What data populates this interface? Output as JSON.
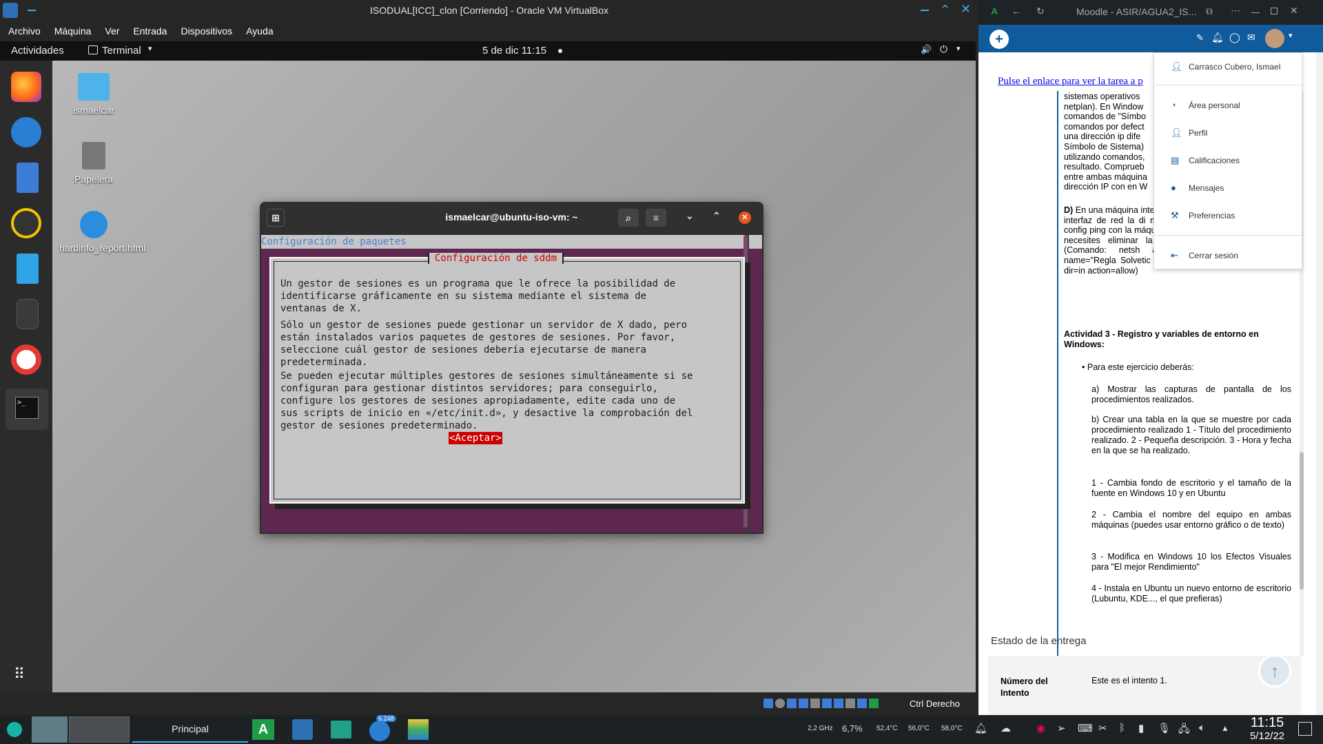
{
  "vbox": {
    "title": "ISODUAL[ICC]_clon [Corriendo] - Oracle VM VirtualBox",
    "menu": [
      "Archivo",
      "Máquina",
      "Ver",
      "Entrada",
      "Dispositivos",
      "Ayuda"
    ],
    "host_key": "Ctrl Derecho"
  },
  "guest": {
    "activities": "Actividades",
    "app_name": "Terminal",
    "clock": "5 de dic  11:15",
    "desktop_icons": [
      "ismaelcar",
      "Papelera",
      "hardinfo_report.html"
    ],
    "terminal": {
      "title": "ismaelcar@ubuntu-iso-vm: ~",
      "header_line": "Configuración de paquetes",
      "dialog_title": "Configuración de sddm",
      "para1": "Un gestor de sesiones es un programa que le ofrece la posibilidad de\nidentificarse gráficamente en su sistema mediante el sistema de\nventanas de X.",
      "para2": "Sólo un gestor de sesiones puede gestionar un servidor de X dado, pero\nestán instalados varios paquetes de gestores de sesiones. Por favor,\nseleccione cuál gestor de sesiones debería ejecutarse de manera\npredeterminada.",
      "para3": "Se pueden ejecutar múltiples gestores de sesiones simultáneamente si se\nconfiguran para gestionar distintos servidores; para conseguirlo,\nconfigure los gestores de sesiones apropiadamente, edite cada uno de\nsus scripts de inicio en «/etc/init.d», y desactive la comprobación del\ngestor de sesiones predeterminado.",
      "ok_button": "<Aceptar>"
    }
  },
  "browser": {
    "title": "Moodle - ASIR/AGUA2_IS...",
    "link_text": "Pulse el enlace para ver la tarea a p",
    "user_name": "Carrasco Cubero, Ismael",
    "menu": [
      "Área personal",
      "Perfil",
      "Calificaciones",
      "Mensajes",
      "Preferencias",
      "Cerrar sesión"
    ],
    "content_lines": [
      "sistemas operativos",
      "netplan). En Window",
      "comandos de \"Símbo",
      "comandos por defect",
      "una dirección ip dife",
      "Símbolo de Sistema)",
      "utilizando comandos,",
      "resultado. Comprueb",
      "entre ambas máquina",
      "dirección IP con en W"
    ],
    "d_title": "D)",
    "d_text": "En una máquina interfaz de red con Utilizando la herram interfaz de red la di máscara 255.255.25 Comprueba la config ping con la máquina de Windows 10. Es posible que necesites eliminar la regla oportuna en el FireWall (Comando: netsh advFirewall Firewall add rule name=\"Regla Solvetic PING IPv4\" protocol=icmpv4:8,any dir=in action=allow)",
    "act3_title": "Actividad 3 - Registro y variables de entorno en Windows:",
    "bullet": "Para este ejercicio deberás:",
    "a_item": "a) Mostrar las capturas de pantalla de los procedimientos realizados.",
    "b_item": "b) Crear una tabla en la que se muestre por cada procedimiento realizado 1 - Título del procedimiento realizado. 2 - Pequeña descripción. 3 - Hora y fecha en la que se ha realizado.",
    "steps": [
      "1 - Cambia fondo de escritorio y el tamaño de la fuente en Windows 10 y en Ubuntu",
      "2 - Cambia el nombre del equipo en ambas máquinas (puedes usar entorno gráfico o de texto)",
      "3 - Modifica en Windows 10 los Efectos Visuales para \"El mejor Rendimiento\"",
      "4 - Instala en Ubuntu un nuevo entorno de escritorio (Lubuntu, KDE..., el que prefieras)"
    ],
    "status_heading": "Estado de la entrega",
    "attempt_label": "Número del Intento",
    "attempt_value": "Este es el intento 1."
  },
  "taskbar": {
    "workspace": "Principal",
    "badge": "6.248",
    "cpu_freq": "2,2 GHz",
    "cpu_pct": "6,7%",
    "temp1": "52,4°C",
    "temp2": "56,0°C",
    "temp3": "58,0°C",
    "time": "11:15",
    "date": "5/12/22"
  }
}
